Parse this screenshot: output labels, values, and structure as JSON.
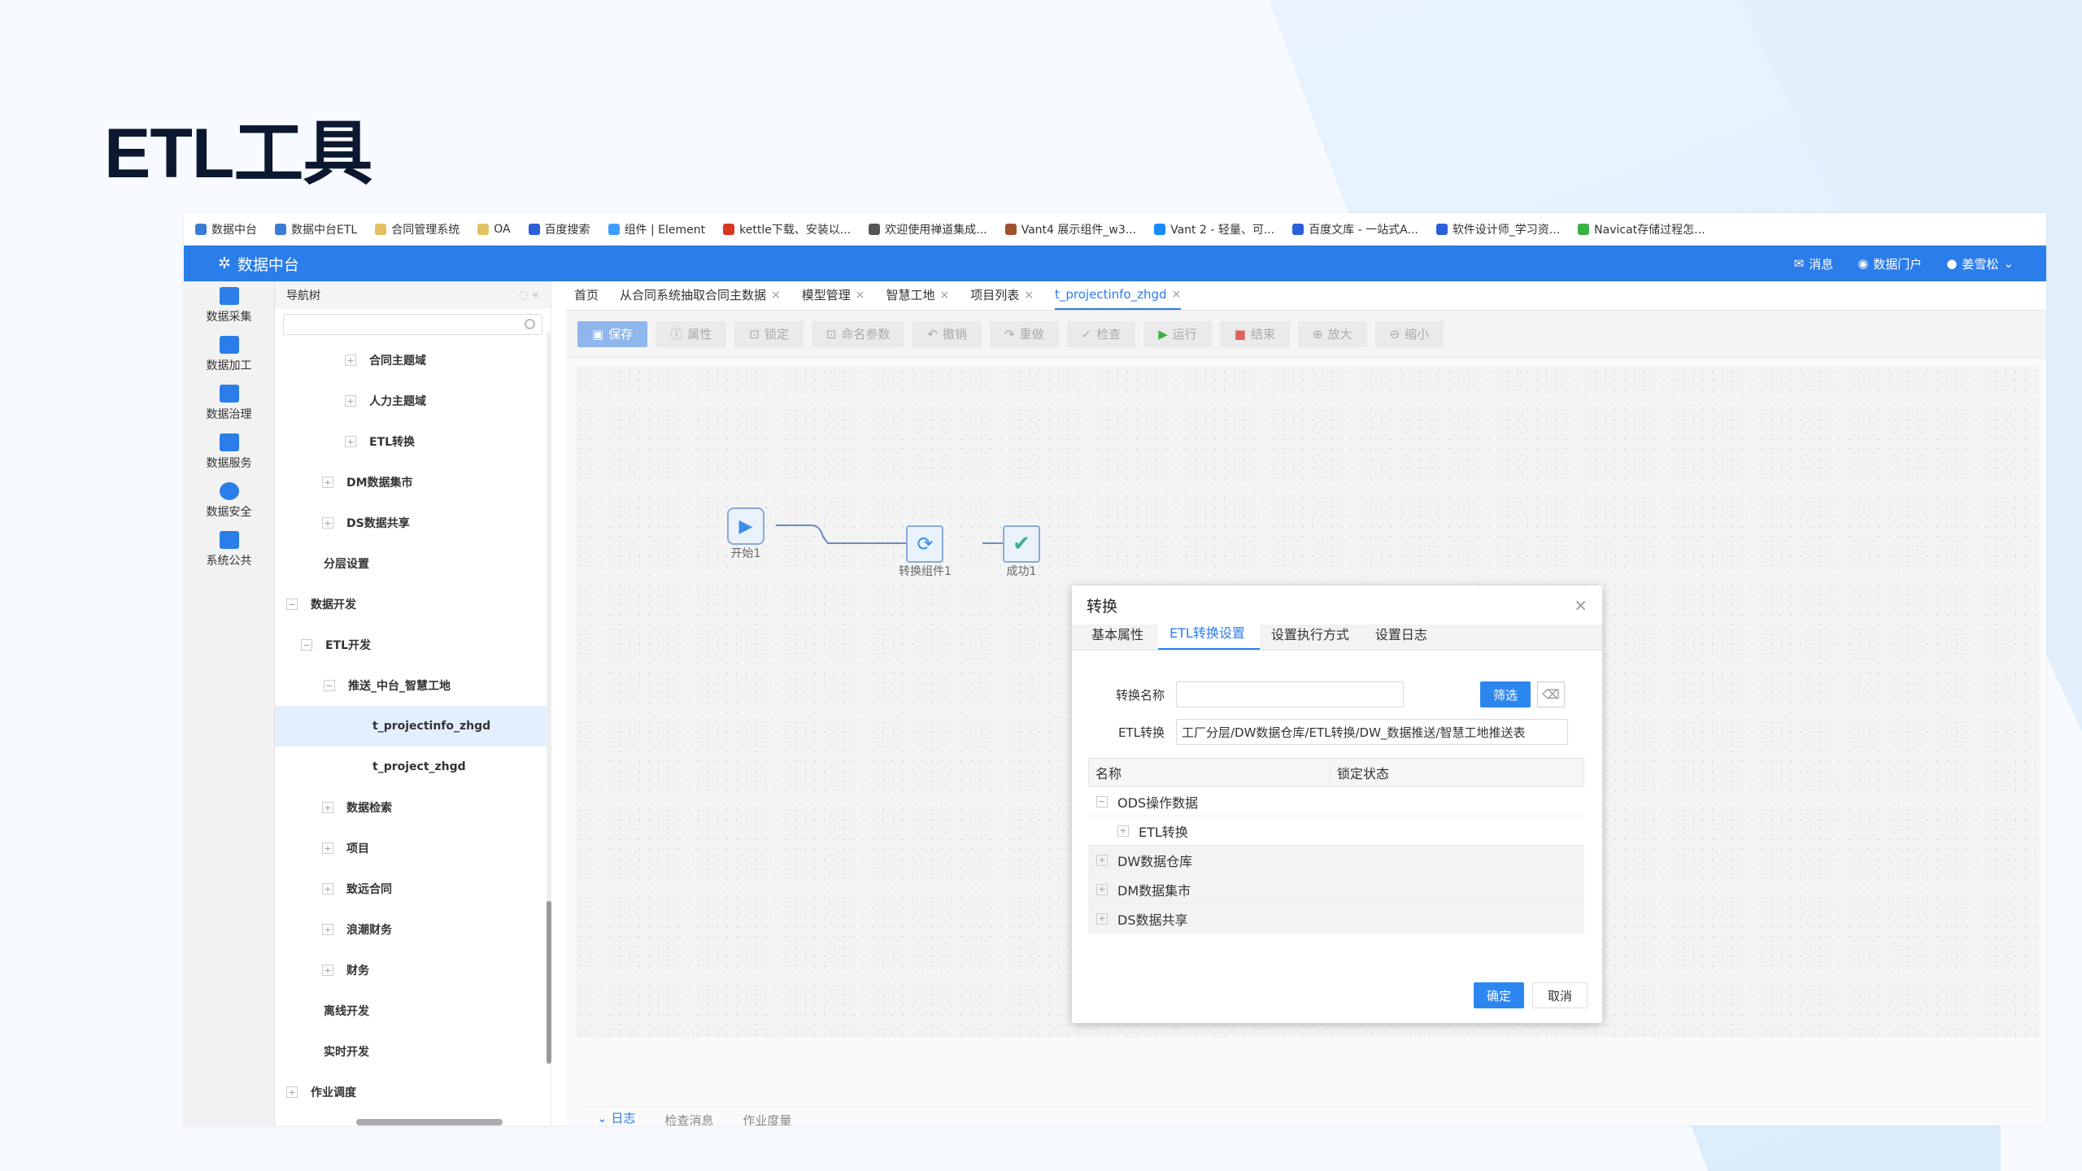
{
  "slide": {
    "title": "ETL工具"
  },
  "bookmarks": [
    "数据中台",
    "数据中台ETL",
    "合同管理系统",
    "OA",
    "百度搜索",
    "组件 | Element",
    "kettle下载、安装以...",
    "欢迎使用禅道集成...",
    "Vant4 展示组件_w3...",
    "Vant 2 - 轻量、可...",
    "百度文库 - 一站式A...",
    "软件设计师_学习资...",
    "Navicat存储过程怎..."
  ],
  "app": {
    "title": "数据中台",
    "message": "消息",
    "portal": "数据门户",
    "user": "姜雪松"
  },
  "leftnav": [
    "数据采集",
    "数据加工",
    "数据治理",
    "数据服务",
    "数据安全",
    "系统公共"
  ],
  "tree": {
    "header": "导航树",
    "nodes": [
      "合同主题域",
      "人力主题域",
      "ETL转换",
      "DM数据集市",
      "DS数据共享",
      "分层设置",
      "数据开发",
      "ETL开发",
      "推送_中台_智慧工地",
      "t_projectinfo_zhgd",
      "t_project_zhgd",
      "数据检索",
      "项目",
      "致远合同",
      "浪潮财务",
      "财务",
      "离线开发",
      "实时开发",
      "作业调度"
    ]
  },
  "tabs": [
    "首页",
    "从合同系统抽取合同主数据",
    "模型管理",
    "智慧工地",
    "项目列表",
    "t_projectinfo_zhgd"
  ],
  "toolbar": [
    "保存",
    "属性",
    "锁定",
    "命名参数",
    "撤销",
    "重做",
    "检查",
    "运行",
    "结束",
    "放大",
    "缩小"
  ],
  "flow": {
    "start": "开始1",
    "transform": "转换组件1",
    "success": "成功1"
  },
  "logbar": [
    "日志",
    "检查消息",
    "作业度量"
  ],
  "dialog": {
    "title": "转换",
    "tabs": [
      "基本属性",
      "ETL转换设置",
      "设置执行方式",
      "设置日志"
    ],
    "name_label": "转换名称",
    "name_value": "",
    "filter": "筛选",
    "etl_label": "ETL转换",
    "etl_value": "工厂分层/DW数据仓库/ETL转换/DW_数据推送/智慧工地推送表",
    "col_name": "名称",
    "col_lock": "锁定状态",
    "rows": [
      "ODS操作数据",
      "ETL转换",
      "DW数据仓库",
      "DM数据集市",
      "DS数据共享"
    ],
    "ok": "确定",
    "cancel": "取消"
  },
  "colors": {
    "accent": "#2b7de9",
    "title": "#0c1830"
  }
}
